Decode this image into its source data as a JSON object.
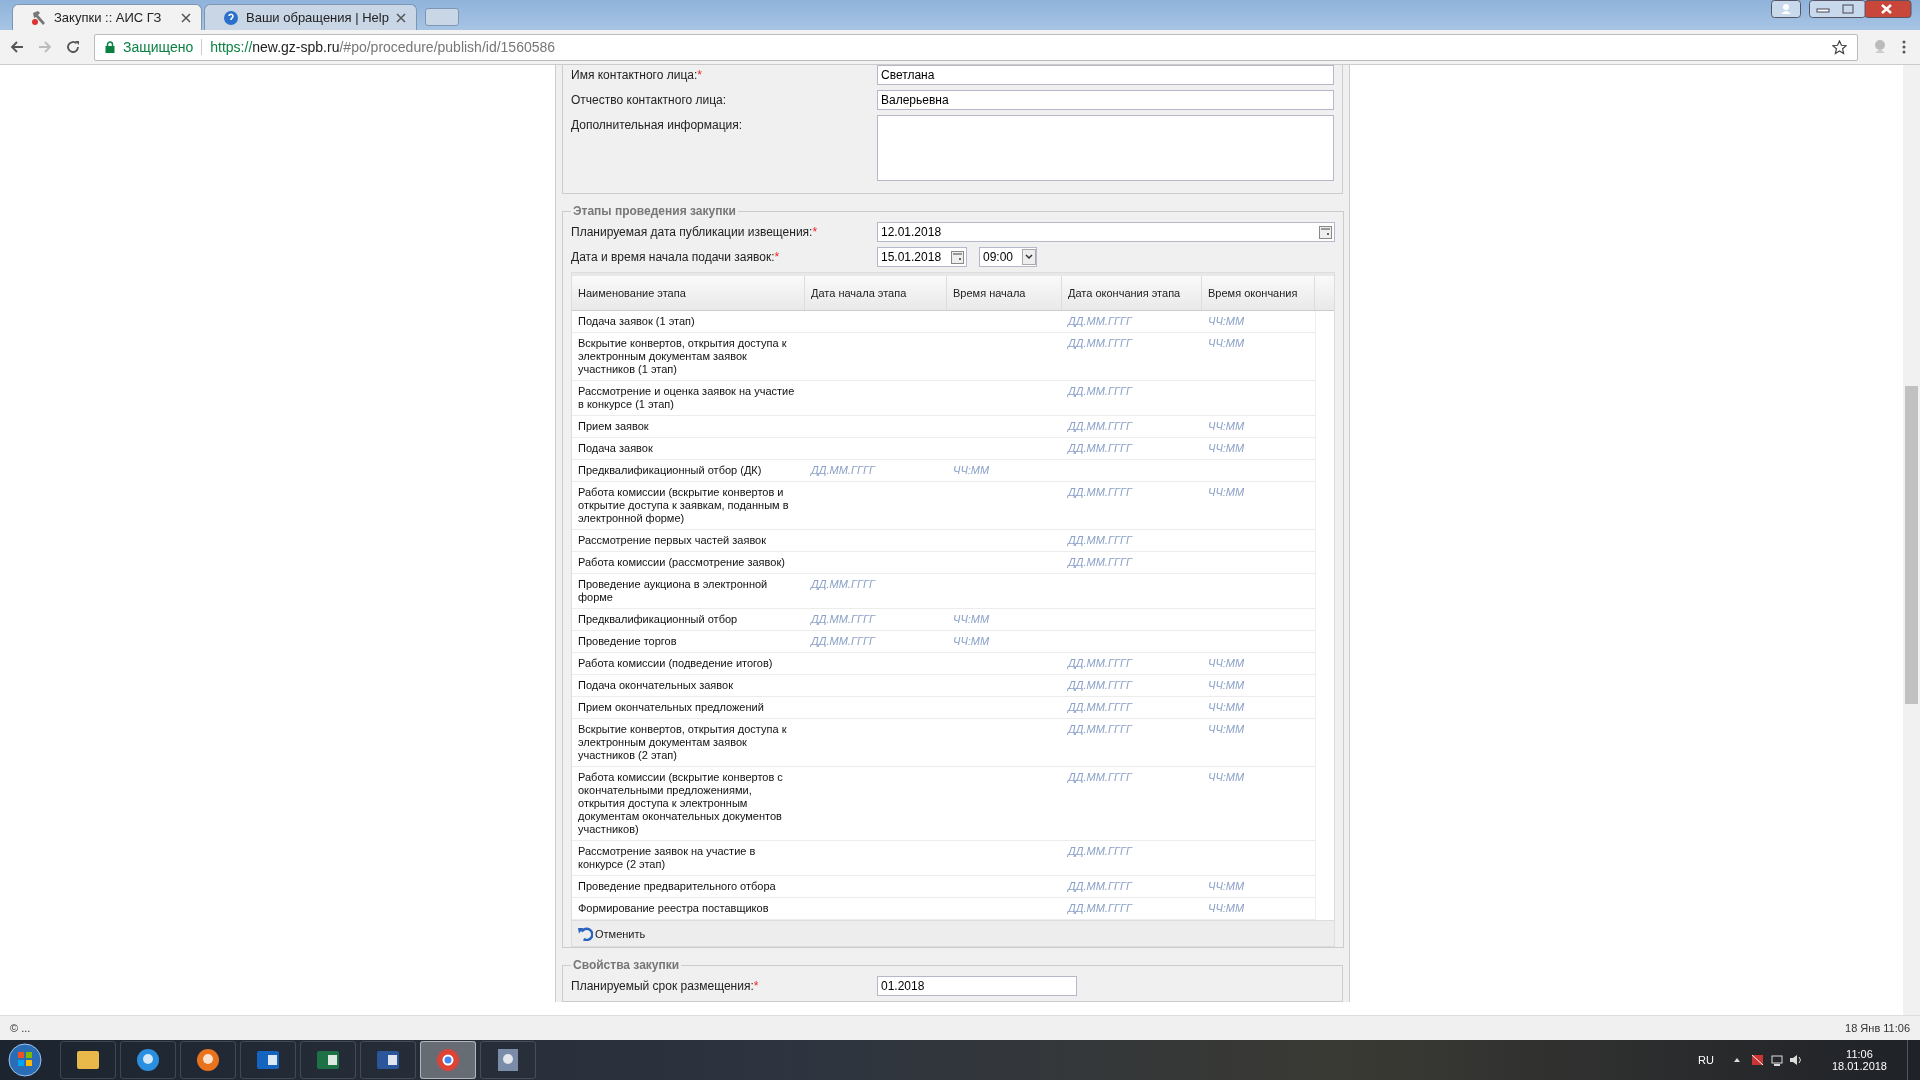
{
  "browser": {
    "tabs": [
      {
        "title": "Закупки :: АИС ГЗ",
        "selected": true
      },
      {
        "title": "Ваши обращения | Help",
        "selected": false
      }
    ],
    "security": "Защищено",
    "url": {
      "scheme": "https://",
      "host": "new.gz-spb.ru",
      "path": "/#po/procedure/publish/id/1560586"
    }
  },
  "contact_fields": [
    {
      "label": "Имя контактного лица:",
      "required_mark": "*",
      "kind": "input",
      "value": "Светлана"
    },
    {
      "label": "Отчество контактного лица:",
      "kind": "input",
      "value": "Валерьевна"
    },
    {
      "label": "Дополнительная информация:",
      "kind": "textarea"
    }
  ],
  "stages": {
    "legend": "Этапы проведения закупки",
    "publish_date": {
      "label": "Планируемая дата публикации извещения:",
      "required_mark": "*",
      "value": "12.01.2018"
    },
    "start": {
      "label": "Дата и время начала подачи заявок:",
      "required_mark": "*",
      "date": "15.01.2018",
      "time": "09:00"
    },
    "table": {
      "columns": [
        "Наименование этапа",
        "Дата начала этапа",
        "Время начала",
        "Дата окончания этапа",
        "Время окончания"
      ],
      "rows": [
        {
          "name": "Подача заявок (1 этап)",
          "end_date": "ДД.ММ.ГГГГ",
          "end_time": "ЧЧ:ММ"
        },
        {
          "name": "Вскрытие конвертов, открытия доступа к электронным документам заявок участников (1 этап)",
          "end_date": "ДД.ММ.ГГГГ",
          "end_time": "ЧЧ:ММ"
        },
        {
          "name": "Рассмотрение и оценка заявок на участие в конкурсе (1 этап)",
          "end_date": "ДД.ММ.ГГГГ"
        },
        {
          "name": "Прием заявок",
          "end_date": "ДД.ММ.ГГГГ",
          "end_time": "ЧЧ:ММ"
        },
        {
          "name": "Подача заявок",
          "end_date": "ДД.ММ.ГГГГ",
          "end_time": "ЧЧ:ММ"
        },
        {
          "name": "Предквалификационный отбор (ДК)",
          "start_date": "ДД.ММ.ГГГГ",
          "start_time": "ЧЧ:ММ"
        },
        {
          "name": "Работа комиссии (вскрытие конвертов и открытие доступа к заявкам, поданным в электронной форме)",
          "end_date": "ДД.ММ.ГГГГ",
          "end_time": "ЧЧ:ММ"
        },
        {
          "name": "Рассмотрение первых частей заявок",
          "end_date": "ДД.ММ.ГГГГ"
        },
        {
          "name": "Работа комиссии (рассмотрение заявок)",
          "end_date": "ДД.ММ.ГГГГ"
        },
        {
          "name": "Проведение аукциона в электронной форме",
          "start_date": "ДД.ММ.ГГГГ"
        },
        {
          "name": "Предквалификационный отбор",
          "start_date": "ДД.ММ.ГГГГ",
          "start_time": "ЧЧ:ММ"
        },
        {
          "name": "Проведение торгов",
          "start_date": "ДД.ММ.ГГГГ",
          "start_time": "ЧЧ:ММ"
        },
        {
          "name": "Работа комиссии (подведение итогов)",
          "end_date": "ДД.ММ.ГГГГ",
          "end_time": "ЧЧ:ММ"
        },
        {
          "name": "Подача окончательных заявок",
          "end_date": "ДД.ММ.ГГГГ",
          "end_time": "ЧЧ:ММ"
        },
        {
          "name": "Прием окончательных предложений",
          "end_date": "ДД.ММ.ГГГГ",
          "end_time": "ЧЧ:ММ"
        },
        {
          "name": "Вскрытие конвертов, открытия доступа к электронным документам заявок участников (2 этап)",
          "end_date": "ДД.ММ.ГГГГ",
          "end_time": "ЧЧ:ММ"
        },
        {
          "name": "Работа комиссии (вскрытие конвертов с окончательными предложениями, открытия доступа к электронным документам окончательных документов участников)",
          "end_date": "ДД.ММ.ГГГГ",
          "end_time": "ЧЧ:ММ"
        },
        {
          "name": "Рассмотрение заявок на участие в конкурсе (2 этап)",
          "end_date": "ДД.ММ.ГГГГ"
        },
        {
          "name": "Проведение предварительного отбора",
          "end_date": "ДД.ММ.ГГГГ",
          "end_time": "ЧЧ:ММ"
        },
        {
          "name": "Формирование реестра поставщиков",
          "end_date": "ДД.ММ.ГГГГ",
          "end_time": "ЧЧ:ММ"
        }
      ]
    },
    "cancel_button": "Отменить"
  },
  "properties": {
    "legend": "Свойства закупки",
    "fields": [
      {
        "label": "Планируемый срок размещения:",
        "required_mark": "*",
        "value": "01.2018"
      }
    ]
  },
  "status_bar": {
    "left": "© ...",
    "right": "18 Янв 11:06"
  },
  "taskbar": {
    "apps": [
      {
        "kind": "folder",
        "selected": false
      },
      {
        "kind": "ie",
        "selected": false
      },
      {
        "kind": "firefox",
        "selected": false
      },
      {
        "kind": "outlook",
        "selected": false
      },
      {
        "kind": "excel",
        "selected": false
      },
      {
        "kind": "word",
        "selected": false
      },
      {
        "kind": "chrome",
        "selected": true
      },
      {
        "kind": "person",
        "selected": false
      }
    ],
    "language": "RU",
    "time": "11:06",
    "date": "18.01.2018"
  }
}
